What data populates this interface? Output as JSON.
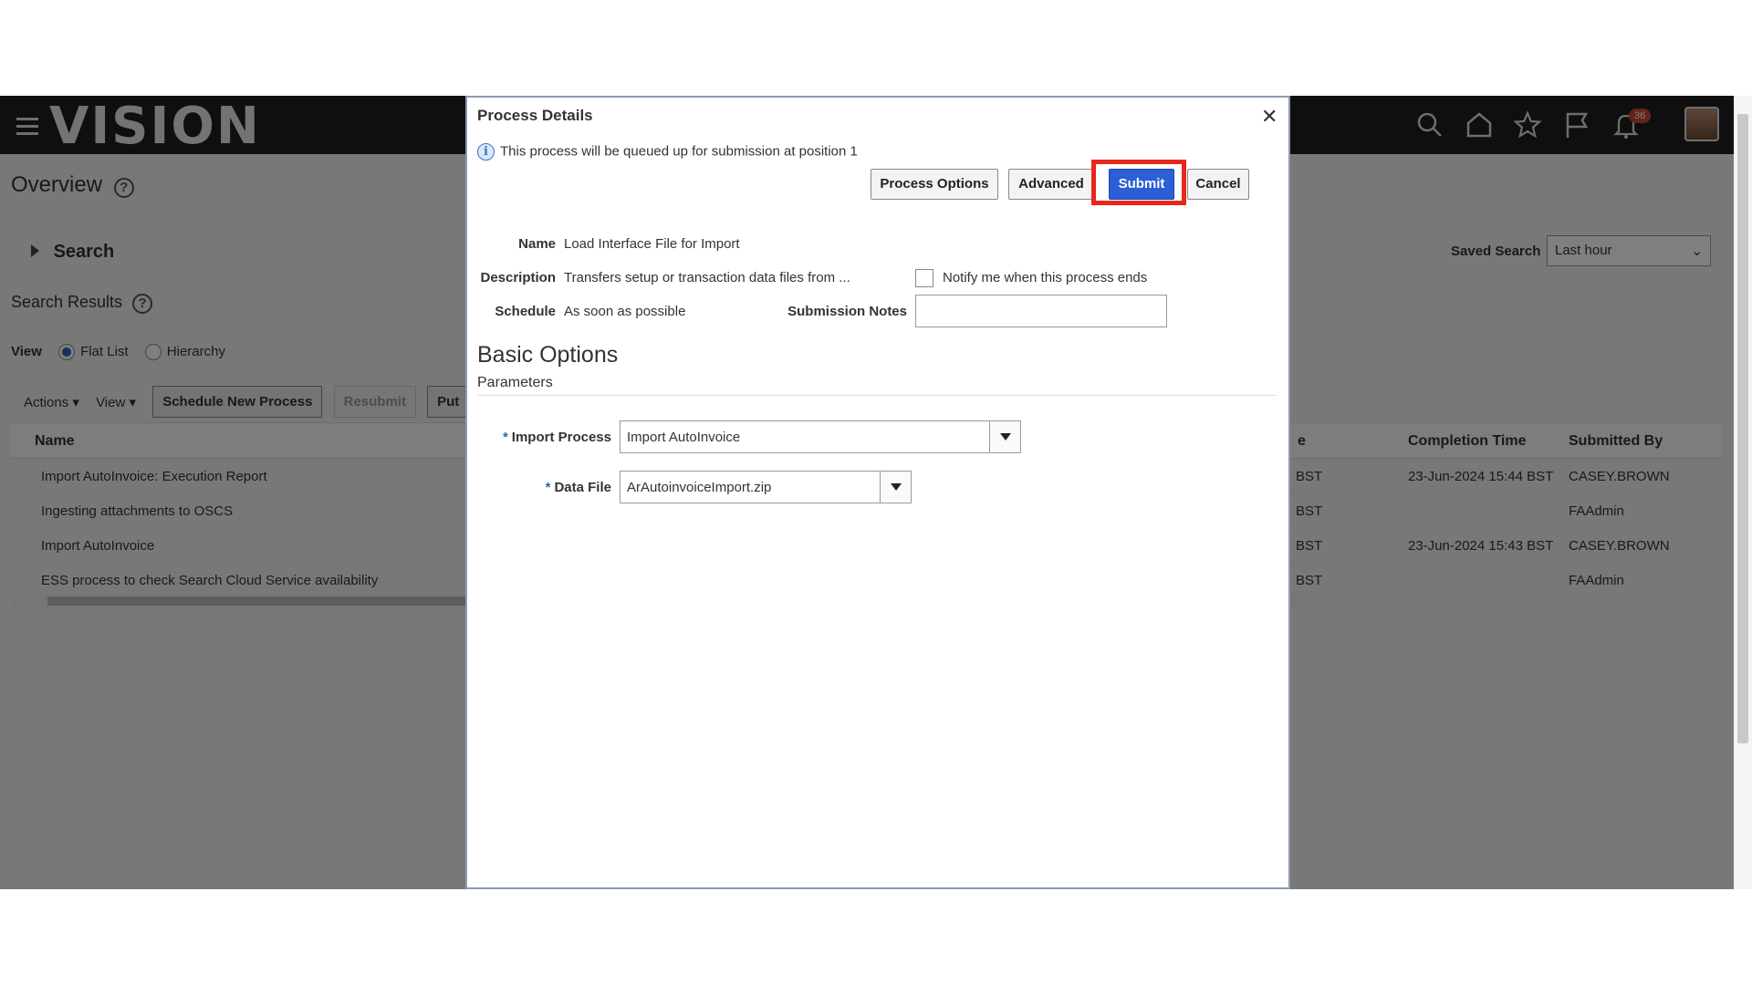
{
  "header": {
    "logo": "VISION",
    "notification_count": "36",
    "icons": [
      "search-icon",
      "home-icon",
      "star-icon",
      "flag-icon",
      "bell-icon"
    ]
  },
  "page": {
    "title": "Overview",
    "search_label": "Search",
    "saved_search_label": "Saved Search",
    "saved_search_value": "Last hour",
    "results_label": "Search Results",
    "view_label": "View",
    "view_options": [
      "Flat List",
      "Hierarchy"
    ],
    "toolbar": {
      "actions": "Actions",
      "view": "View",
      "schedule": "Schedule New Process",
      "resubmit": "Resubmit",
      "put": "Put"
    },
    "columns": {
      "name": "Name",
      "col_e": "e",
      "completion": "Completion Time",
      "submitted_by": "Submitted By"
    },
    "rows": [
      {
        "name": "Import AutoInvoice: Execution Report",
        "tz": "BST",
        "completion": "23-Jun-2024 15:44 BST",
        "by": "CASEY.BROWN"
      },
      {
        "name": "Ingesting attachments to OSCS",
        "tz": "BST",
        "completion": "",
        "by": "FAAdmin"
      },
      {
        "name": "Import AutoInvoice",
        "tz": "BST",
        "completion": "23-Jun-2024 15:43 BST",
        "by": "CASEY.BROWN"
      },
      {
        "name": "ESS process to check Search Cloud Service availability",
        "tz": "BST",
        "completion": "",
        "by": "FAAdmin"
      }
    ]
  },
  "dialog": {
    "title": "Process Details",
    "info": "This process will be queued up for submission at position 1",
    "buttons": {
      "process_options": "Process Options",
      "advanced": "Advanced",
      "submit": "Submit",
      "cancel": "Cancel"
    },
    "name_label": "Name",
    "name_value": "Load Interface File for Import",
    "description_label": "Description",
    "description_value": "Transfers setup or transaction data files from ...",
    "notify_label": "Notify me when this process ends",
    "schedule_label": "Schedule",
    "schedule_value": "As soon as possible",
    "notes_label": "Submission Notes",
    "notes_value": "",
    "basic_options": "Basic Options",
    "parameters": "Parameters",
    "import_process_label": "Import Process",
    "import_process_value": "Import AutoInvoice",
    "data_file_label": "Data File",
    "data_file_value": "ArAutoinvoiceImport.zip",
    "required_marker": "*"
  }
}
